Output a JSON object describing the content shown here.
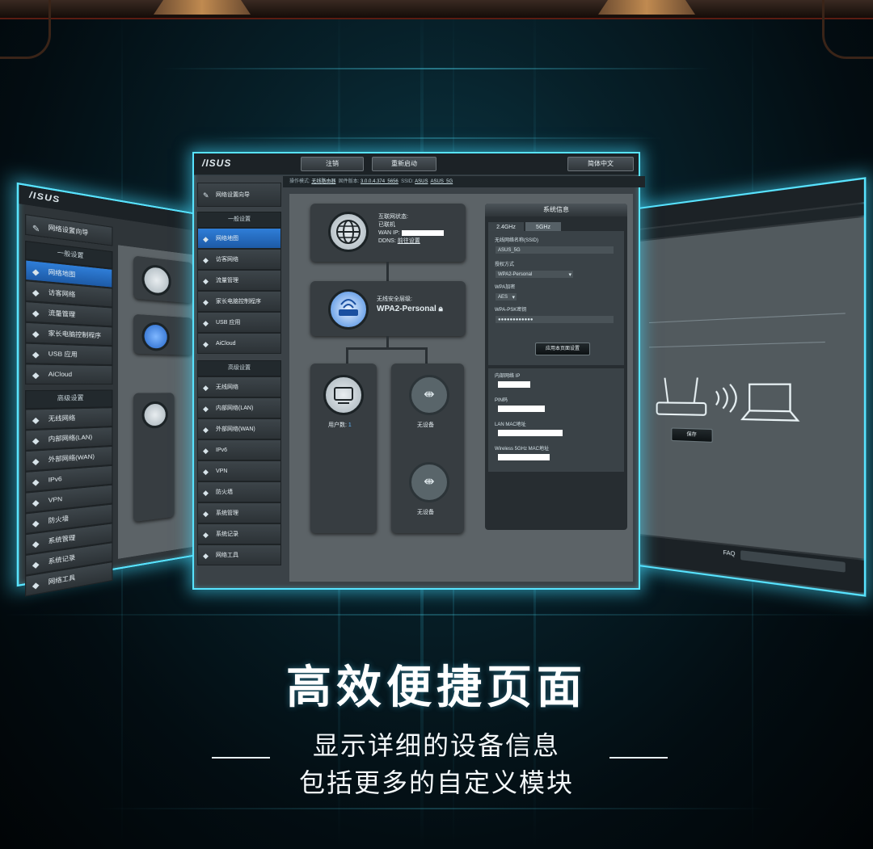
{
  "main_window": {
    "logo": "/ISUS",
    "buttons": [
      "注销",
      "重新启动",
      "简体中文"
    ],
    "infobar": {
      "mode_label": "操作模式:",
      "mode_value": "无线路由器",
      "firmware_label": "固件版本:",
      "firmware_value": "3.0.0.4.374_5656",
      "ssid_label": "SSID:",
      "ssid_values": [
        "ASUS",
        "ASUS_5G"
      ]
    },
    "quick_setup": "网络设置向导",
    "general_header": "一般设置",
    "general_items": [
      {
        "label": "网络地图",
        "icon": "network-map-icon"
      },
      {
        "label": "访客网络",
        "icon": "guest-network-icon"
      },
      {
        "label": "流量管理",
        "icon": "traffic-manager-icon"
      },
      {
        "label": "家长电脑控制程序",
        "icon": "parental-control-icon"
      },
      {
        "label": "USB 应用",
        "icon": "usb-app-icon"
      },
      {
        "label": "AiCloud",
        "icon": "aicloud-icon"
      }
    ],
    "advanced_header": "高级设置",
    "advanced_items": [
      {
        "label": "无线网络",
        "icon": "wireless-icon"
      },
      {
        "label": "内部网络(LAN)",
        "icon": "lan-icon"
      },
      {
        "label": "外部网络(WAN)",
        "icon": "wan-icon"
      },
      {
        "label": "IPv6",
        "icon": "ipv6-icon"
      },
      {
        "label": "VPN",
        "icon": "vpn-icon"
      },
      {
        "label": "防火墙",
        "icon": "firewall-icon"
      },
      {
        "label": "系统管理",
        "icon": "admin-icon"
      },
      {
        "label": "系统记录",
        "icon": "log-icon"
      },
      {
        "label": "网络工具",
        "icon": "tools-icon"
      }
    ],
    "internet": {
      "status_label": "互联网状态:",
      "status_value": "已联机",
      "wan_ip_label": "WAN IP:",
      "ddns_label": "DDNS:",
      "ddns_link": "前往设置"
    },
    "security": {
      "label": "无线安全层级:",
      "value": "WPA2-Personal"
    },
    "clients": {
      "label": "用户数:",
      "value": "1"
    },
    "usb_slots": [
      "无设备",
      "无设备"
    ],
    "sysinfo": {
      "title": "系统信息",
      "tabs": [
        "2.4GHz",
        "5GHz"
      ],
      "ssid_label": "无线网络名称(SSID)",
      "ssid_value": "ASUS_5G",
      "auth_label": "授权方式",
      "auth_value": "WPA2-Personal",
      "wpa_enc_label": "WPA加密",
      "wpa_enc_value": "AES",
      "psk_label": "WPA-PSK密钥",
      "psk_value": "●●●●●●●●●●●●",
      "apply_button": "应用本页面设置",
      "lan_ip_label": "内部网络 IP",
      "pin_label": "PIN码",
      "lan_mac_label": "LAN MAC地址",
      "wl_mac_label": "Wireless 5GHz MAC地址"
    }
  },
  "left_window": {
    "logo": "/ISUS",
    "quick_setup": "网络设置向导",
    "general_header": "一般设置",
    "items": [
      "网络地图",
      "访客网络",
      "流量管理",
      "家长电脑控制程序",
      "USB 应用",
      "AiCloud"
    ],
    "advanced_header": "高级设置",
    "advanced_items": [
      "无线网络",
      "内部网络(LAN)",
      "外部网络(WAN)",
      "IPv6",
      "VPN",
      "防火墙",
      "系统管理",
      "系统记录",
      "网络工具"
    ]
  },
  "right_window": {
    "faq": "FAQ",
    "save_button": "保存"
  },
  "marketing": {
    "headline": "高效便捷页面",
    "line1": "显示详细的设备信息",
    "line2": "包括更多的自定义模块"
  }
}
